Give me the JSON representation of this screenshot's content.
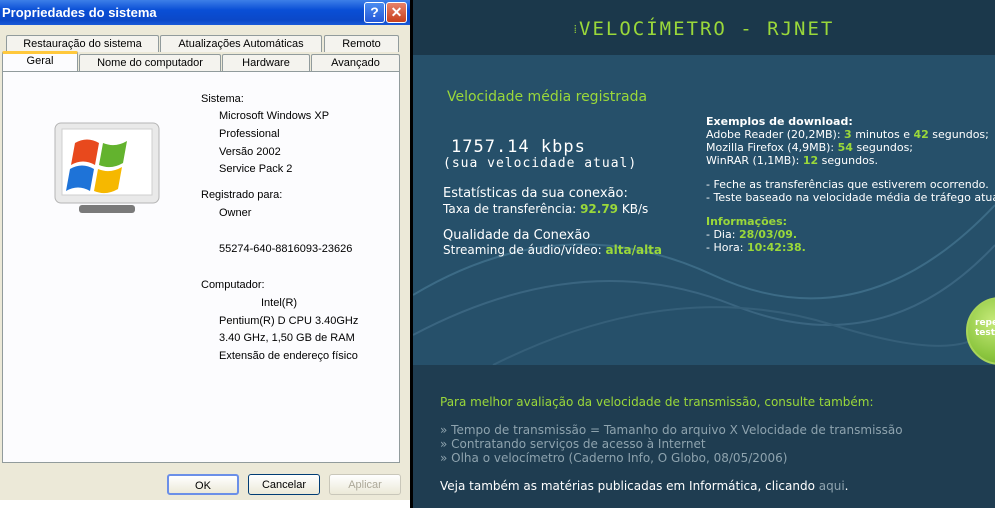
{
  "dialog": {
    "title": "Propriedades do sistema",
    "help_glyph": "?",
    "close_glyph": "✕",
    "tabs_row1": [
      "Restauração do sistema",
      "Atualizações Automáticas",
      "Remoto"
    ],
    "tabs_row2": [
      "Geral",
      "Nome do computador",
      "Hardware",
      "Avançado"
    ],
    "active_tab": "Geral",
    "system_label": "Sistema:",
    "system_lines": [
      "Microsoft Windows XP",
      "Professional",
      "Versão 2002",
      "Service Pack 2"
    ],
    "registered_label": "Registrado para:",
    "registered_owner": "Owner",
    "product_id": "55274-640-8816093-23626",
    "computer_label": "Computador:",
    "computer_lines": [
      "Intel(R)",
      "Pentium(R) D CPU 3.40GHz",
      "3.40 GHz, 1,50 GB de RAM",
      "Extensão de endereço físico"
    ],
    "buttons": {
      "ok": "OK",
      "cancel": "Cancelar",
      "apply": "Aplicar"
    }
  },
  "speedtest": {
    "title": "VELOCÍMETRO - RJNET",
    "avg_title": "Velocidade média registrada",
    "speed_value": "1757.14 kbps",
    "speed_caption": "(sua velocidade atual)",
    "stats_heading": "Estatísticas da sua conexão:",
    "rate_label": "Taxa de transferência:",
    "rate_value": "92.79",
    "rate_unit": "KB/s",
    "quality_heading": "Qualidade da Conexão",
    "streaming_label": "Streaming de áudio/vídeo:",
    "streaming_value": "alta/alta",
    "examples_heading": "Exemplos de download:",
    "examples": [
      {
        "name": "Adobe Reader (20,2MB):",
        "min": "3",
        "min_label": "minutos e",
        "sec": "42",
        "sec_label": "segundos;"
      },
      {
        "name": "Mozilla Firefox (4,9MB):",
        "sec": "54",
        "sec_label": "segundos;"
      },
      {
        "name": "WinRAR (1,1MB):",
        "sec": "12",
        "sec_label": "segundos."
      }
    ],
    "notes": [
      "- Feche as transferências que estiverem ocorrendo.",
      "- Teste baseado na velocidade média de tráfego atual."
    ],
    "info_heading": "Informações:",
    "day_label": "- Dia:",
    "day_value": "28/03/09.",
    "hour_label": "- Hora:",
    "hour_value": "10:42:38.",
    "repeat_label": "repetir teste",
    "better_eval": "Para melhor avaliação da velocidade de transmissão, consulte também:",
    "links": [
      "» Tempo de transmissão = Tamanho do arquivo X Velocidade de transmissão",
      "» Contratando serviços de acesso à Internet",
      "» Olha o velocímetro (Caderno Info, O Globo, 08/05/2006)"
    ],
    "see_also": "Veja também as matérias publicadas em Informática, clicando",
    "here_link": "aqui",
    "period": "."
  }
}
